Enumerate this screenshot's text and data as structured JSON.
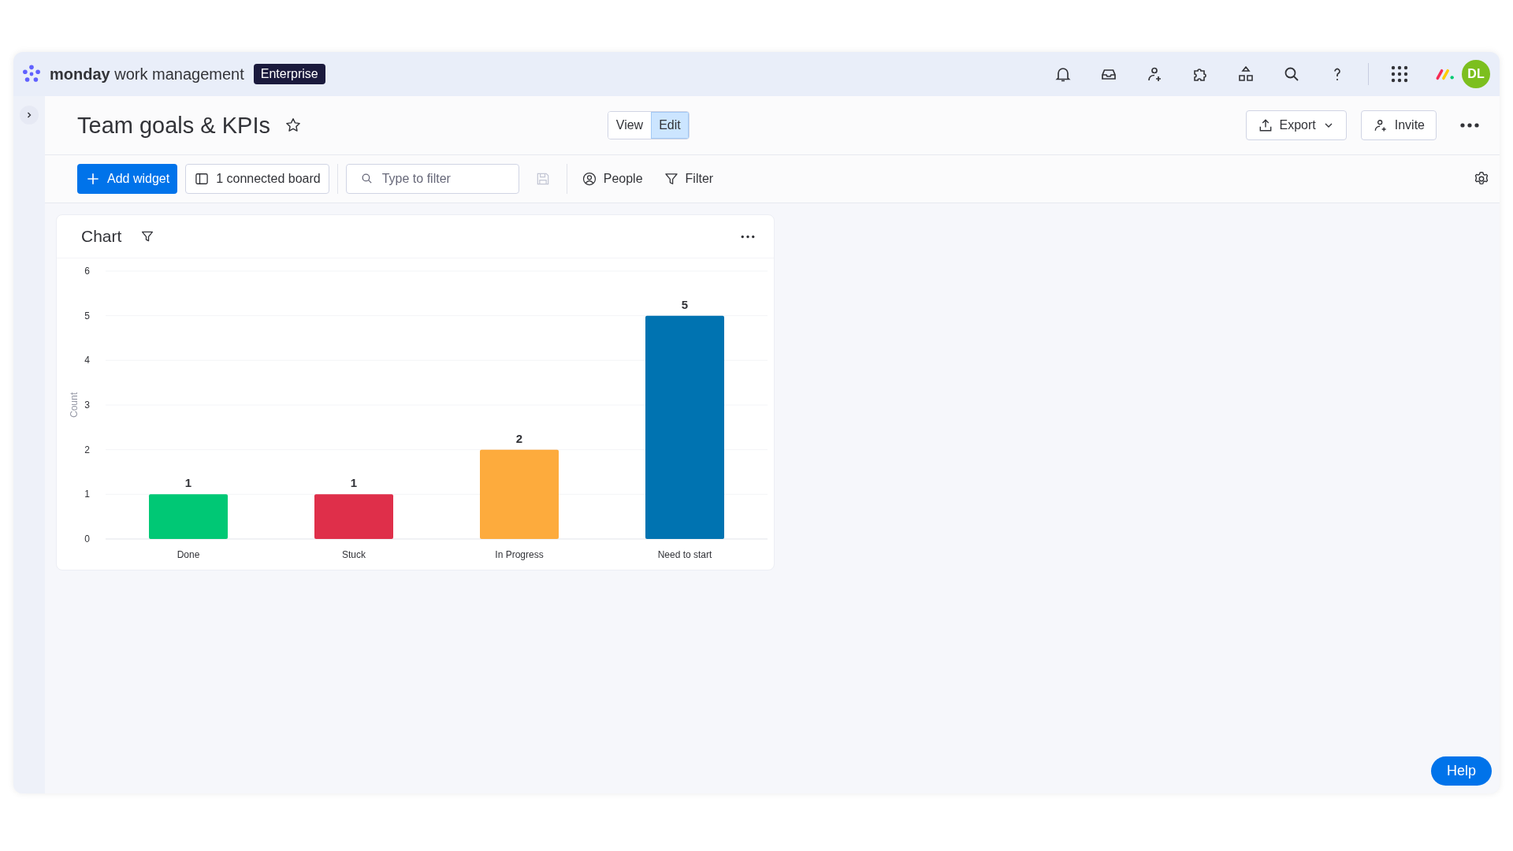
{
  "app": {
    "brand": "monday",
    "product": "work management",
    "plan": "Enterprise",
    "avatar": "DL"
  },
  "header": {
    "title": "Team goals & KPIs",
    "modes": [
      {
        "label": "View",
        "selected": false
      },
      {
        "label": "Edit",
        "selected": true
      }
    ],
    "export": "Export",
    "invite": "Invite"
  },
  "toolbar": {
    "add": "Add widget",
    "boards": "1 connected board",
    "search": {
      "placeholder": "Type to filter"
    },
    "people": "People",
    "filter": "Filter"
  },
  "widget": {
    "title": "Chart",
    "chart_data": {
      "type": "bar",
      "ylabel": "Count",
      "grid": true,
      "data_labels": true,
      "ylim": [
        0,
        6
      ],
      "yticks": [
        0,
        1,
        2,
        3,
        4,
        5,
        6
      ],
      "series": [
        {
          "name": "Done",
          "color": "#00c875",
          "values": [
            1
          ]
        },
        {
          "name": "Stuck",
          "color": "#df2f4a",
          "values": [
            1
          ]
        },
        {
          "name": "In Progress",
          "color": "#fdab3d",
          "values": [
            2
          ]
        },
        {
          "name": "Need to start",
          "color": "#0073b1",
          "values": [
            5
          ]
        }
      ]
    }
  },
  "help": "Help"
}
